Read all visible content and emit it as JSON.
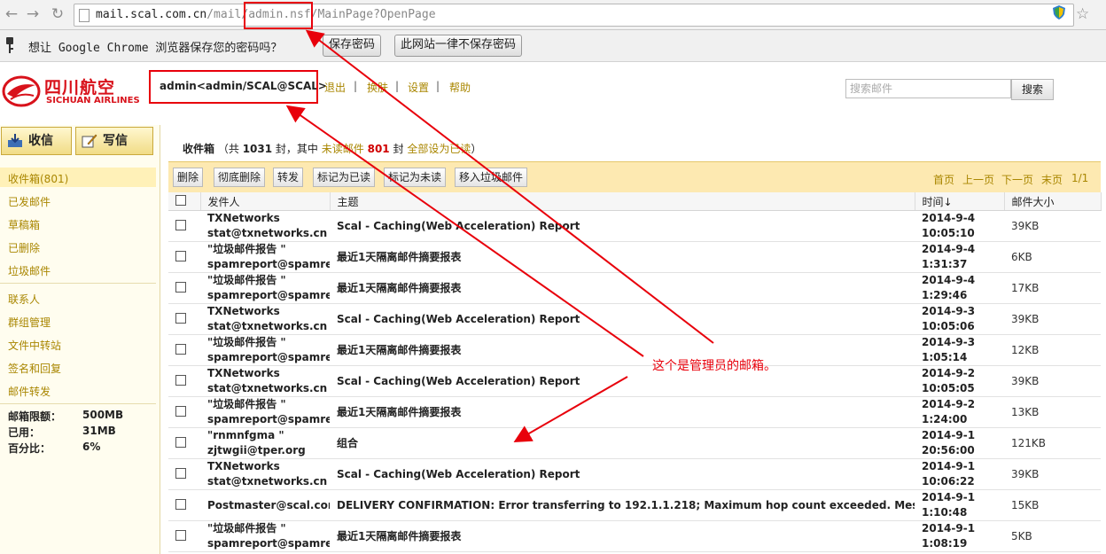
{
  "browser": {
    "url_host": "mail.scal.com.cn",
    "url_path": "/mail/admin.nsf/MainPage?OpenPage",
    "save_password_prompt": "想让 Google Chrome 浏览器保存您的密码吗？",
    "save_password_button": "保存密码",
    "never_save_button": "此网站一律不保存密码"
  },
  "brand": {
    "logo_cn": "四川航空",
    "logo_en": "SICHUAN AIRLINES",
    "color": "#d8121b"
  },
  "header": {
    "user": "admin<admin/SCAL@SCAL>",
    "links": [
      "退出",
      "换肤",
      "设置",
      "帮助"
    ],
    "search_placeholder": "搜索邮件",
    "search_button": "搜索"
  },
  "sidebar": {
    "compose_receive": "收信",
    "compose_write": "写信",
    "folders": [
      "收件箱(801)",
      "已发邮件",
      "草稿箱",
      "已删除",
      "垃圾邮件"
    ],
    "tools": [
      "联系人",
      "群组管理",
      "文件中转站",
      "签名和回复",
      "邮件转发"
    ],
    "quota": [
      {
        "label": "邮箱限额：",
        "value": "500MB"
      },
      {
        "label": "已用：",
        "value": "31MB"
      },
      {
        "label": "百分比：",
        "value": "6%"
      }
    ]
  },
  "inbox": {
    "title": "收件箱",
    "total_prefix": "（共",
    "total": "1031",
    "total_suffix": "封，其中",
    "unread_label": "未读邮件",
    "unread": "801",
    "unread_suffix": "封",
    "mark_all_read": "全部设为已读",
    "close_paren": "）"
  },
  "toolbar": {
    "buttons": [
      "删除",
      "彻底删除",
      "转发",
      "标记为已读",
      "标记为未读",
      "移入垃圾邮件"
    ],
    "pager": [
      "首页",
      "上一页",
      "下一页",
      "末页",
      "1/1"
    ]
  },
  "table": {
    "columns": [
      "发件人",
      "主题",
      "时间↓",
      "邮件大小"
    ],
    "rows": [
      {
        "sender1": "TXNetworks",
        "sender2": "stat@txnetworks.cn",
        "subject": "Scal - Caching(Web Acceleration) Report",
        "date": "2014-9-4",
        "time": "10:05:10",
        "size": "39KB"
      },
      {
        "sender1": "\"垃圾邮件报告 \"",
        "sender2": "spamreport@spamrep",
        "subject": "最近1天隔离邮件摘要报表",
        "date": "2014-9-4",
        "time": "1:31:37",
        "size": "6KB"
      },
      {
        "sender1": "\"垃圾邮件报告 \"",
        "sender2": "spamreport@spamrep",
        "subject": "最近1天隔离邮件摘要报表",
        "date": "2014-9-4",
        "time": "1:29:46",
        "size": "17KB"
      },
      {
        "sender1": "TXNetworks",
        "sender2": "stat@txnetworks.cn",
        "subject": "Scal - Caching(Web Acceleration) Report",
        "date": "2014-9-3",
        "time": "10:05:06",
        "size": "39KB"
      },
      {
        "sender1": "\"垃圾邮件报告 \"",
        "sender2": "spamreport@spamrep",
        "subject": "最近1天隔离邮件摘要报表",
        "date": "2014-9-3",
        "time": "1:05:14",
        "size": "12KB"
      },
      {
        "sender1": "TXNetworks",
        "sender2": "stat@txnetworks.cn",
        "subject": "Scal - Caching(Web Acceleration) Report",
        "date": "2014-9-2",
        "time": "10:05:05",
        "size": "39KB"
      },
      {
        "sender1": "\"垃圾邮件报告 \"",
        "sender2": "spamreport@spamrep",
        "subject": "最近1天隔离邮件摘要报表",
        "date": "2014-9-2",
        "time": "1:24:00",
        "size": "13KB"
      },
      {
        "sender1": "\"rnmnfgma \"",
        "sender2": "zjtwgii@tper.org",
        "subject": "组合",
        "date": "2014-9-1",
        "time": "20:56:00",
        "size": "121KB"
      },
      {
        "sender1": "TXNetworks",
        "sender2": "stat@txnetworks.cn",
        "subject": "Scal - Caching(Web Acceleration) Report",
        "date": "2014-9-1",
        "time": "10:06:22",
        "size": "39KB"
      },
      {
        "sender1": "Postmaster@scal.com.",
        "sender2": "",
        "subject": "DELIVERY CONFIRMATION: Error transferring to 192.1.1.218; Maximum hop count exceeded. Message probably in a routing loop.",
        "date": "2014-9-1",
        "time": "1:10:48",
        "size": "15KB"
      },
      {
        "sender1": "\"垃圾邮件报告 \"",
        "sender2": "spamreport@spamrep",
        "subject": "最近1天隔离邮件摘要报表",
        "date": "2014-9-1",
        "time": "1:08:19",
        "size": "5KB"
      }
    ]
  },
  "annotation": {
    "text": "这个是管理员的邮箱。",
    "color": "#e8000b"
  }
}
